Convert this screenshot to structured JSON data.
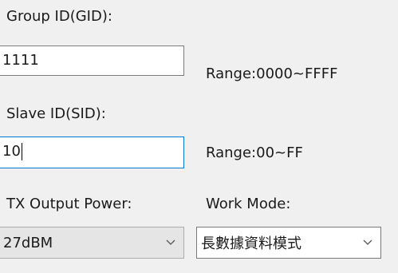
{
  "group_id": {
    "label": "Group ID(GID):",
    "value": "1111",
    "range": "Range:0000~FFFF"
  },
  "slave_id": {
    "label": "Slave ID(SID):",
    "value": "10",
    "range": "Range:00~FF"
  },
  "tx_output_power": {
    "label": "TX Output Power:",
    "selected": "27dBM"
  },
  "work_mode": {
    "label": "Work Mode:",
    "selected": "長數據資料模式"
  },
  "colors": {
    "window_background": "#f0f0f0",
    "focus_border": "#0078d7",
    "field_border": "#7a7a7a"
  },
  "icons": {
    "dropdown": "chevron-down-icon"
  }
}
